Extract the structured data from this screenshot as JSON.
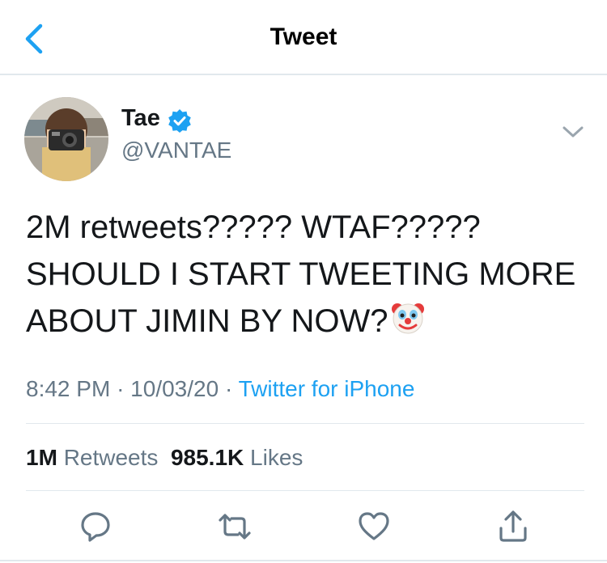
{
  "header": {
    "title": "Tweet",
    "back_icon": "chevron-left-icon"
  },
  "author": {
    "name": "Tae",
    "handle": "@VANTAE",
    "verified": true,
    "avatar": "profile-photo"
  },
  "tweet": {
    "lines": [
      "2M retweets????? WTAF?????",
      "SHOULD  I START TWEETING MORE",
      "ABOUT JIMIN BY NOW?"
    ],
    "emoji": "clown-face"
  },
  "meta": {
    "time": "8:42 PM",
    "dot1": "·",
    "date": "10/03/20",
    "dot2": "·",
    "source": "Twitter for iPhone"
  },
  "stats": {
    "retweets_count": "1M",
    "retweets_label": "Retweets",
    "likes_count": "985.1K",
    "likes_label": "Likes"
  },
  "actions": [
    "reply-icon",
    "retweet-icon",
    "like-icon",
    "share-icon"
  ],
  "colors": {
    "accent": "#1da1f2",
    "muted": "#657786",
    "text": "#14171a",
    "divider": "#e1e8ed"
  }
}
